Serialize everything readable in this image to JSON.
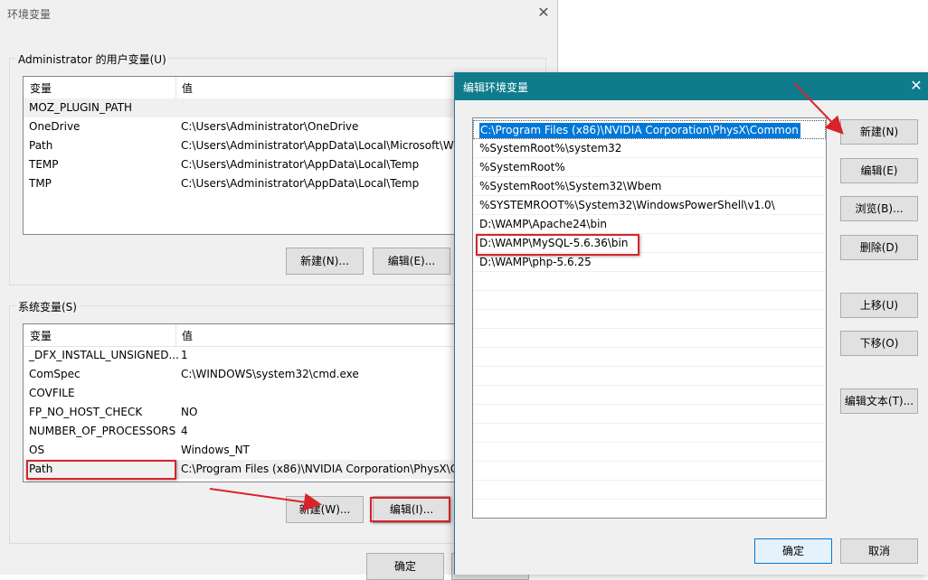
{
  "env_window": {
    "title": "环境变量",
    "close_glyph": "✕",
    "user_group_label": "Administrator 的用户变量(U)",
    "system_group_label": "系统变量(S)",
    "col_variable": "变量",
    "col_value": "值",
    "user_vars": [
      {
        "name": "MOZ_PLUGIN_PATH",
        "value": ""
      },
      {
        "name": "OneDrive",
        "value": "C:\\Users\\Administrator\\OneDrive"
      },
      {
        "name": "Path",
        "value": "C:\\Users\\Administrator\\AppData\\Local\\Microsoft\\W"
      },
      {
        "name": "TEMP",
        "value": "C:\\Users\\Administrator\\AppData\\Local\\Temp"
      },
      {
        "name": "TMP",
        "value": "C:\\Users\\Administrator\\AppData\\Local\\Temp"
      }
    ],
    "system_vars": [
      {
        "name": "_DFX_INSTALL_UNSIGNED...",
        "value": "1"
      },
      {
        "name": "ComSpec",
        "value": "C:\\WINDOWS\\system32\\cmd.exe"
      },
      {
        "name": "COVFILE",
        "value": ""
      },
      {
        "name": "FP_NO_HOST_CHECK",
        "value": "NO"
      },
      {
        "name": "NUMBER_OF_PROCESSORS",
        "value": "4"
      },
      {
        "name": "OS",
        "value": "Windows_NT"
      },
      {
        "name": "Path",
        "value": "C:\\Program Files (x86)\\NVIDIA Corporation\\PhysX\\C"
      }
    ],
    "user_buttons": {
      "new": "新建(N)...",
      "edit": "编辑(E)..."
    },
    "system_buttons": {
      "new": "新建(W)...",
      "edit": "编辑(I)..."
    },
    "ok_button": "确定"
  },
  "edit_dialog": {
    "title": "编辑环境变量",
    "close_glyph": "✕",
    "paths": [
      "C:\\Program Files (x86)\\NVIDIA Corporation\\PhysX\\Common",
      "%SystemRoot%\\system32",
      "%SystemRoot%",
      "%SystemRoot%\\System32\\Wbem",
      "%SYSTEMROOT%\\System32\\WindowsPowerShell\\v1.0\\",
      "D:\\WAMP\\Apache24\\bin",
      "D:\\WAMP\\MySQL-5.6.36\\bin",
      "D:\\WAMP\\php-5.6.25"
    ],
    "buttons": {
      "new": "新建(N)",
      "edit": "编辑(E)",
      "browse": "浏览(B)...",
      "delete": "删除(D)",
      "move_up": "上移(U)",
      "move_down": "下移(O)",
      "edit_text": "编辑文本(T)...",
      "ok": "确定",
      "cancel": "取消"
    }
  },
  "colors": {
    "dialog_titlebar": "#0e7c8c",
    "selection": "#0078d7",
    "annotation_red": "#d9232a"
  }
}
